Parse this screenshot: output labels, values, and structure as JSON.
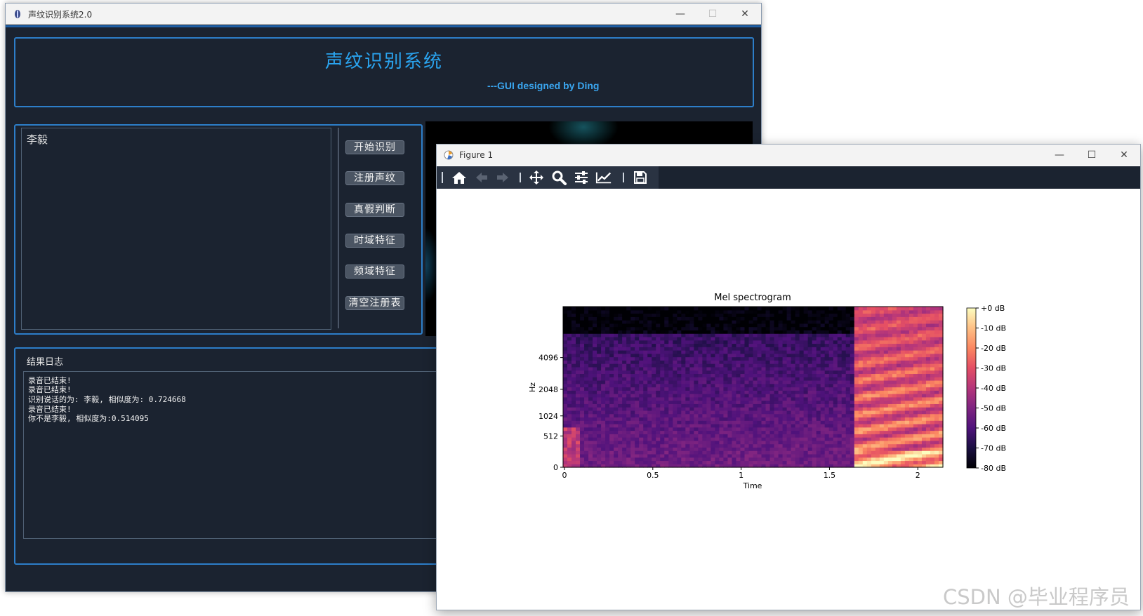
{
  "main_window": {
    "title": "声纹识别系统2.0",
    "controls": {
      "minimize": "—",
      "maximize": "☐",
      "close": "✕"
    },
    "header": {
      "title": "声纹识别系统",
      "subtitle": "---GUI designed by Ding"
    },
    "speaker_text": "李毅",
    "buttons": [
      "开始识别",
      "注册声纹",
      "真假判断",
      "时域特征",
      "频域特征",
      "清空注册表"
    ],
    "log": {
      "label": "结果日志",
      "lines": [
        "录音已结束!",
        "录音已结束!",
        "识别说话的为: 李毅, 相似度为: 0.724668",
        "录音已结束!",
        "你不是李毅, 相似度为:0.514095"
      ]
    }
  },
  "figure_window": {
    "title": "Figure 1",
    "controls": {
      "minimize": "—",
      "maximize": "☐",
      "close": "✕"
    },
    "toolbar_icons": [
      "home-icon",
      "back-icon",
      "forward-icon",
      "pan-icon",
      "zoom-icon",
      "configure-subplots-icon",
      "edit-axis-icon",
      "save-icon"
    ]
  },
  "chart_data": {
    "type": "heatmap",
    "title": "Mel spectrogram",
    "xlabel": "Time",
    "ylabel": "Hz",
    "x_ticks": [
      0,
      0.5,
      1,
      1.5,
      2
    ],
    "x_tick_labels": [
      "0",
      "0.5",
      "1",
      "1.5",
      "2"
    ],
    "xlim": [
      0,
      2.15
    ],
    "y_tick_labels": [
      "0",
      "512",
      "1024",
      "2048",
      "4096"
    ],
    "y_scale": "mel",
    "colorbar": {
      "colormap": "magma",
      "ticks": [
        "+0 dB",
        "-10 dB",
        "-20 dB",
        "-30 dB",
        "-40 dB",
        "-50 dB",
        "-60 dB",
        "-70 dB",
        "-80 dB"
      ],
      "range_db": [
        -80,
        0
      ]
    },
    "description_values": {
      "speech_regions_seconds": [
        [
          0,
          0.1
        ],
        [
          1.65,
          2.15
        ]
      ],
      "background_level_db": -65,
      "speech_peak_level_db": -5
    }
  },
  "watermark": "CSDN @毕业程序员",
  "colors": {
    "main_bg": "#1b2330",
    "accent": "#2d7ec9",
    "title_blue": "#2aa3ee",
    "button_bg": "#4b5563"
  }
}
